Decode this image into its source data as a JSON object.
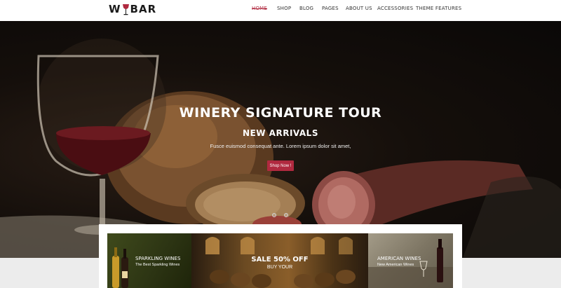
{
  "logo": {
    "text_left": "W",
    "text_right": "BAR"
  },
  "nav": {
    "items": [
      {
        "label": "HOME",
        "active": true
      },
      {
        "label": "SHOP"
      },
      {
        "label": "BLOG"
      },
      {
        "label": "PAGES"
      },
      {
        "label": "ABOUT US"
      },
      {
        "label": "ACCESSORIES"
      },
      {
        "label": "THEME FEATURES"
      }
    ]
  },
  "hero": {
    "title": "WINERY SIGNATURE TOUR",
    "subtitle": "NEW ARRIVALS",
    "description": "Fusce euismod consequat ante. Lorem ipsum dolor sit amet,",
    "button_label": "Shop Now !",
    "slides_count": 2,
    "active_slide": 1
  },
  "banners": [
    {
      "title": "SPARKLING WINES",
      "subtitle": "The Best Sparkling Wines"
    },
    {
      "title": "SALE 50% OFF",
      "subtitle": "BUY YOUR"
    },
    {
      "title": "AMERICAN WINES",
      "subtitle": "New American Wines"
    }
  ],
  "colors": {
    "accent": "#b0293f",
    "header_bg": "#ffffff",
    "section_bg": "#ececec"
  }
}
